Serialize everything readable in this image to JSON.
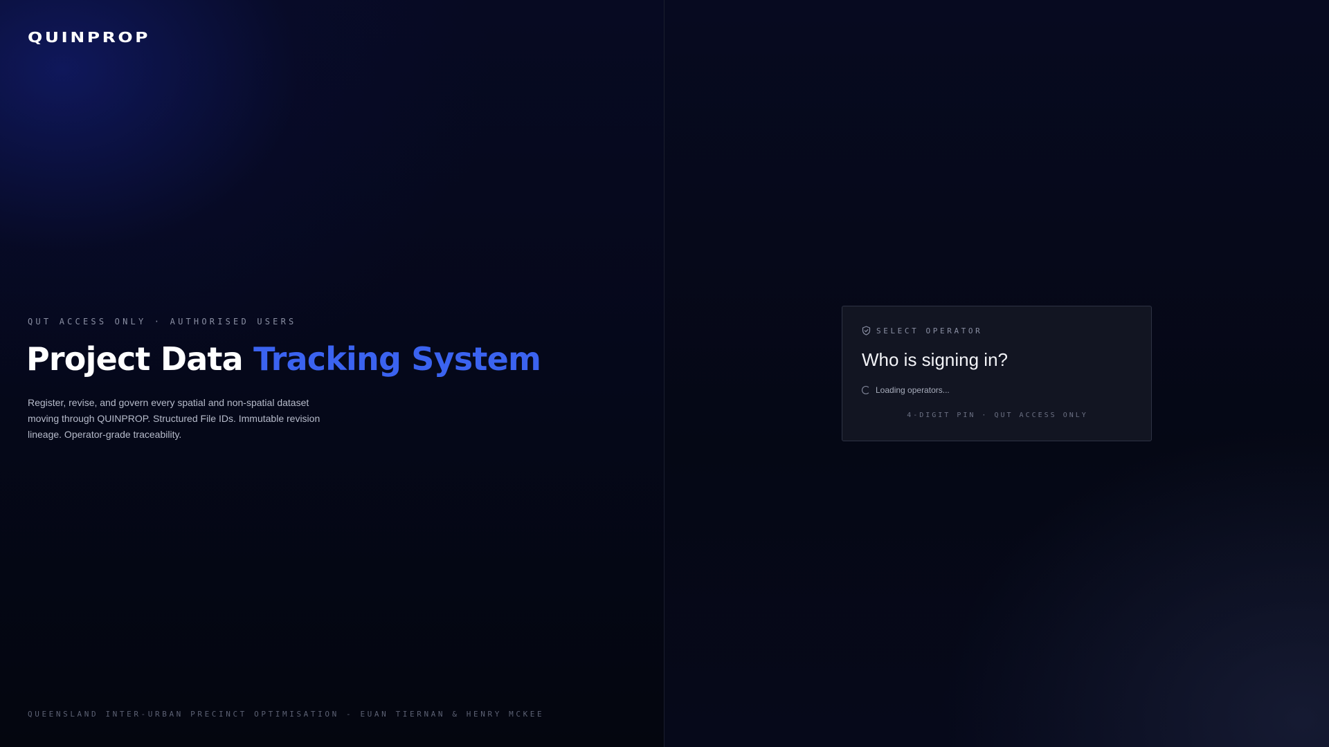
{
  "brand": {
    "logo_text": "QUINPROP"
  },
  "hero": {
    "eyebrow": "QUT ACCESS ONLY · AUTHORISED USERS",
    "title_plain": "Project Data",
    "title_accent": "Tracking System",
    "description": "Register, revise, and govern every spatial and non-spatial dataset moving through QUINPROP. Structured File IDs. Immutable revision lineage. Operator-grade traceability."
  },
  "footer": {
    "credit": "QUEENSLAND INTER-URBAN PRECINCT OPTIMISATION - EUAN TIERNAN & HENRY MCKEE"
  },
  "login_card": {
    "header_icon": "shield-check-icon",
    "eyebrow": "SELECT OPERATOR",
    "title": "Who is signing in?",
    "loading_icon": "spinner-icon",
    "loading_text": "Loading operators...",
    "footer_note": "4-DIGIT PIN · QUT ACCESS ONLY"
  },
  "colors": {
    "background": "#050815",
    "accent": "#3b63f0",
    "card_bg": "#141724",
    "card_border": "#2e3344",
    "muted_text": "#8a8fa3"
  }
}
